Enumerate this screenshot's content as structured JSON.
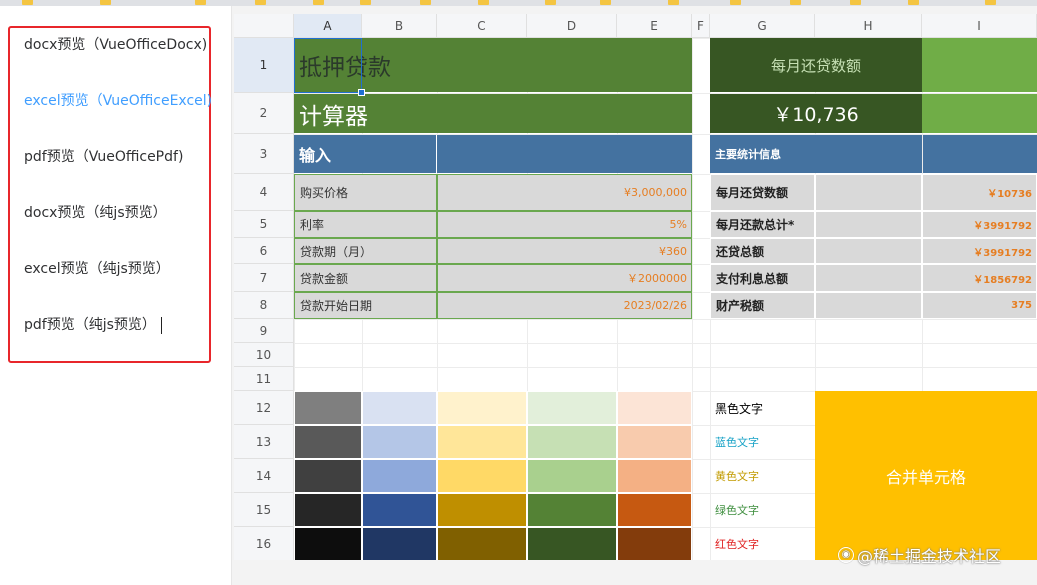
{
  "menu": {
    "items": [
      {
        "label": "docx预览（VueOfficeDocx)",
        "active": false
      },
      {
        "label": "excel预览（VueOfficeExcel)",
        "active": true
      },
      {
        "label": "pdf预览（VueOfficePdf)",
        "active": false
      },
      {
        "label": "docx预览（纯js预览）",
        "active": false
      },
      {
        "label": "excel预览（纯js预览）",
        "active": false
      },
      {
        "label": "pdf预览（纯js预览）",
        "active": false
      }
    ]
  },
  "sheet": {
    "columns": [
      "A",
      "B",
      "C",
      "D",
      "E",
      "F",
      "G",
      "H",
      "I"
    ],
    "rows": [
      "1",
      "2",
      "3",
      "4",
      "5",
      "6",
      "7",
      "8",
      "9",
      "10",
      "11",
      "12",
      "13",
      "14",
      "15",
      "16"
    ],
    "title_line1": "抵押贷款",
    "title_line2": "计算器",
    "monthly_payment_label": "每月还贷数额",
    "monthly_payment_value": "￥10,736",
    "input_header": "输入",
    "stats_header": "主要统计信息",
    "inputs": [
      {
        "label": "购买价格",
        "value": "¥3,000,000"
      },
      {
        "label": "利率",
        "value": "5%"
      },
      {
        "label": "贷款期（月）",
        "value": "¥360"
      },
      {
        "label": "贷款金额",
        "value": "￥2000000"
      },
      {
        "label": "贷款开始日期",
        "value": "2023/02/26"
      }
    ],
    "stats": [
      {
        "label": "每月还贷数额",
        "value": "￥10736"
      },
      {
        "label": "每月还款总计*",
        "value": "￥3991792"
      },
      {
        "label": "还贷总额",
        "value": "￥3991792"
      },
      {
        "label": "支付利息总额",
        "value": "￥1856792"
      },
      {
        "label": "财产税额",
        "value": "375"
      }
    ],
    "color_texts": [
      {
        "label": "黑色文字",
        "color": "#000000"
      },
      {
        "label": "蓝色文字",
        "color": "#17a2c6"
      },
      {
        "label": "黄色文字",
        "color": "#c29b00"
      },
      {
        "label": "绿色文字",
        "color": "#3e8e3e"
      },
      {
        "label": "红色文字",
        "color": "#e02020"
      }
    ],
    "merged_label": "合并单元格",
    "swatch_colors": [
      [
        "#7f7f7f",
        "#d9e1f2",
        "#fff2cc",
        "#e2efda",
        "#fce4d6"
      ],
      [
        "#595959",
        "#b4c6e7",
        "#ffe699",
        "#c6e0b4",
        "#f8cbad"
      ],
      [
        "#404040",
        "#8ea9db",
        "#ffd966",
        "#a9d08e",
        "#f4b084"
      ],
      [
        "#262626",
        "#305496",
        "#bf8f00",
        "#548235",
        "#c65911"
      ],
      [
        "#0d0d0d",
        "#203764",
        "#806000",
        "#375623",
        "#833c0c"
      ]
    ],
    "colors": {
      "title_green": "#548235",
      "dark_green": "#375623",
      "light_green": "#70ad47",
      "header_blue": "#4472a0",
      "merged_orange": "#ffc000"
    }
  },
  "watermark": "@稀土掘金技术社区"
}
